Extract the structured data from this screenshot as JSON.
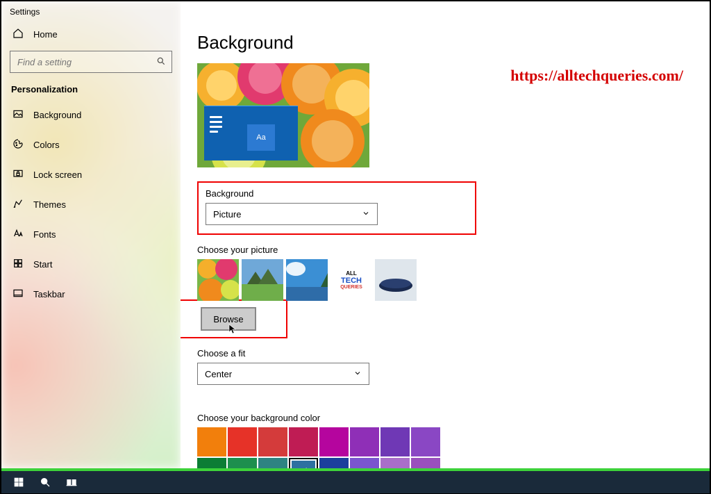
{
  "window_title": "Settings",
  "home_label": "Home",
  "search_placeholder": "Find a setting",
  "section_title": "Personalization",
  "nav": [
    {
      "label": "Background"
    },
    {
      "label": "Colors"
    },
    {
      "label": "Lock screen"
    },
    {
      "label": "Themes"
    },
    {
      "label": "Fonts"
    },
    {
      "label": "Start"
    },
    {
      "label": "Taskbar"
    }
  ],
  "page_title": "Background",
  "preview_text": "Aa",
  "background_group": {
    "label": "Background",
    "value": "Picture"
  },
  "choose_picture_label": "Choose your picture",
  "thumb_alltech_top": "ALL",
  "thumb_alltech_mid": "TECH",
  "thumb_alltech_bot": "QUERIES",
  "browse_label": "Browse",
  "fit_group": {
    "label": "Choose a fit",
    "value": "Center"
  },
  "color_label": "Choose your background color",
  "swatches_row1": [
    "#f27f0c",
    "#e63228",
    "#d43b3b",
    "#bf1c54",
    "#b5059e",
    "#8f2fb7",
    "#6f38b5",
    "#8a47c4"
  ],
  "swatches_row2": [
    "#0c7d35",
    "#1d8f4e",
    "#2e8382",
    "#2e70a1",
    "#1c3f9c",
    "#7b55cf",
    "#a96ec9",
    "#9a4fbd"
  ],
  "selected_swatch_index": 11,
  "watermark_url": "https://alltechqueries.com/"
}
